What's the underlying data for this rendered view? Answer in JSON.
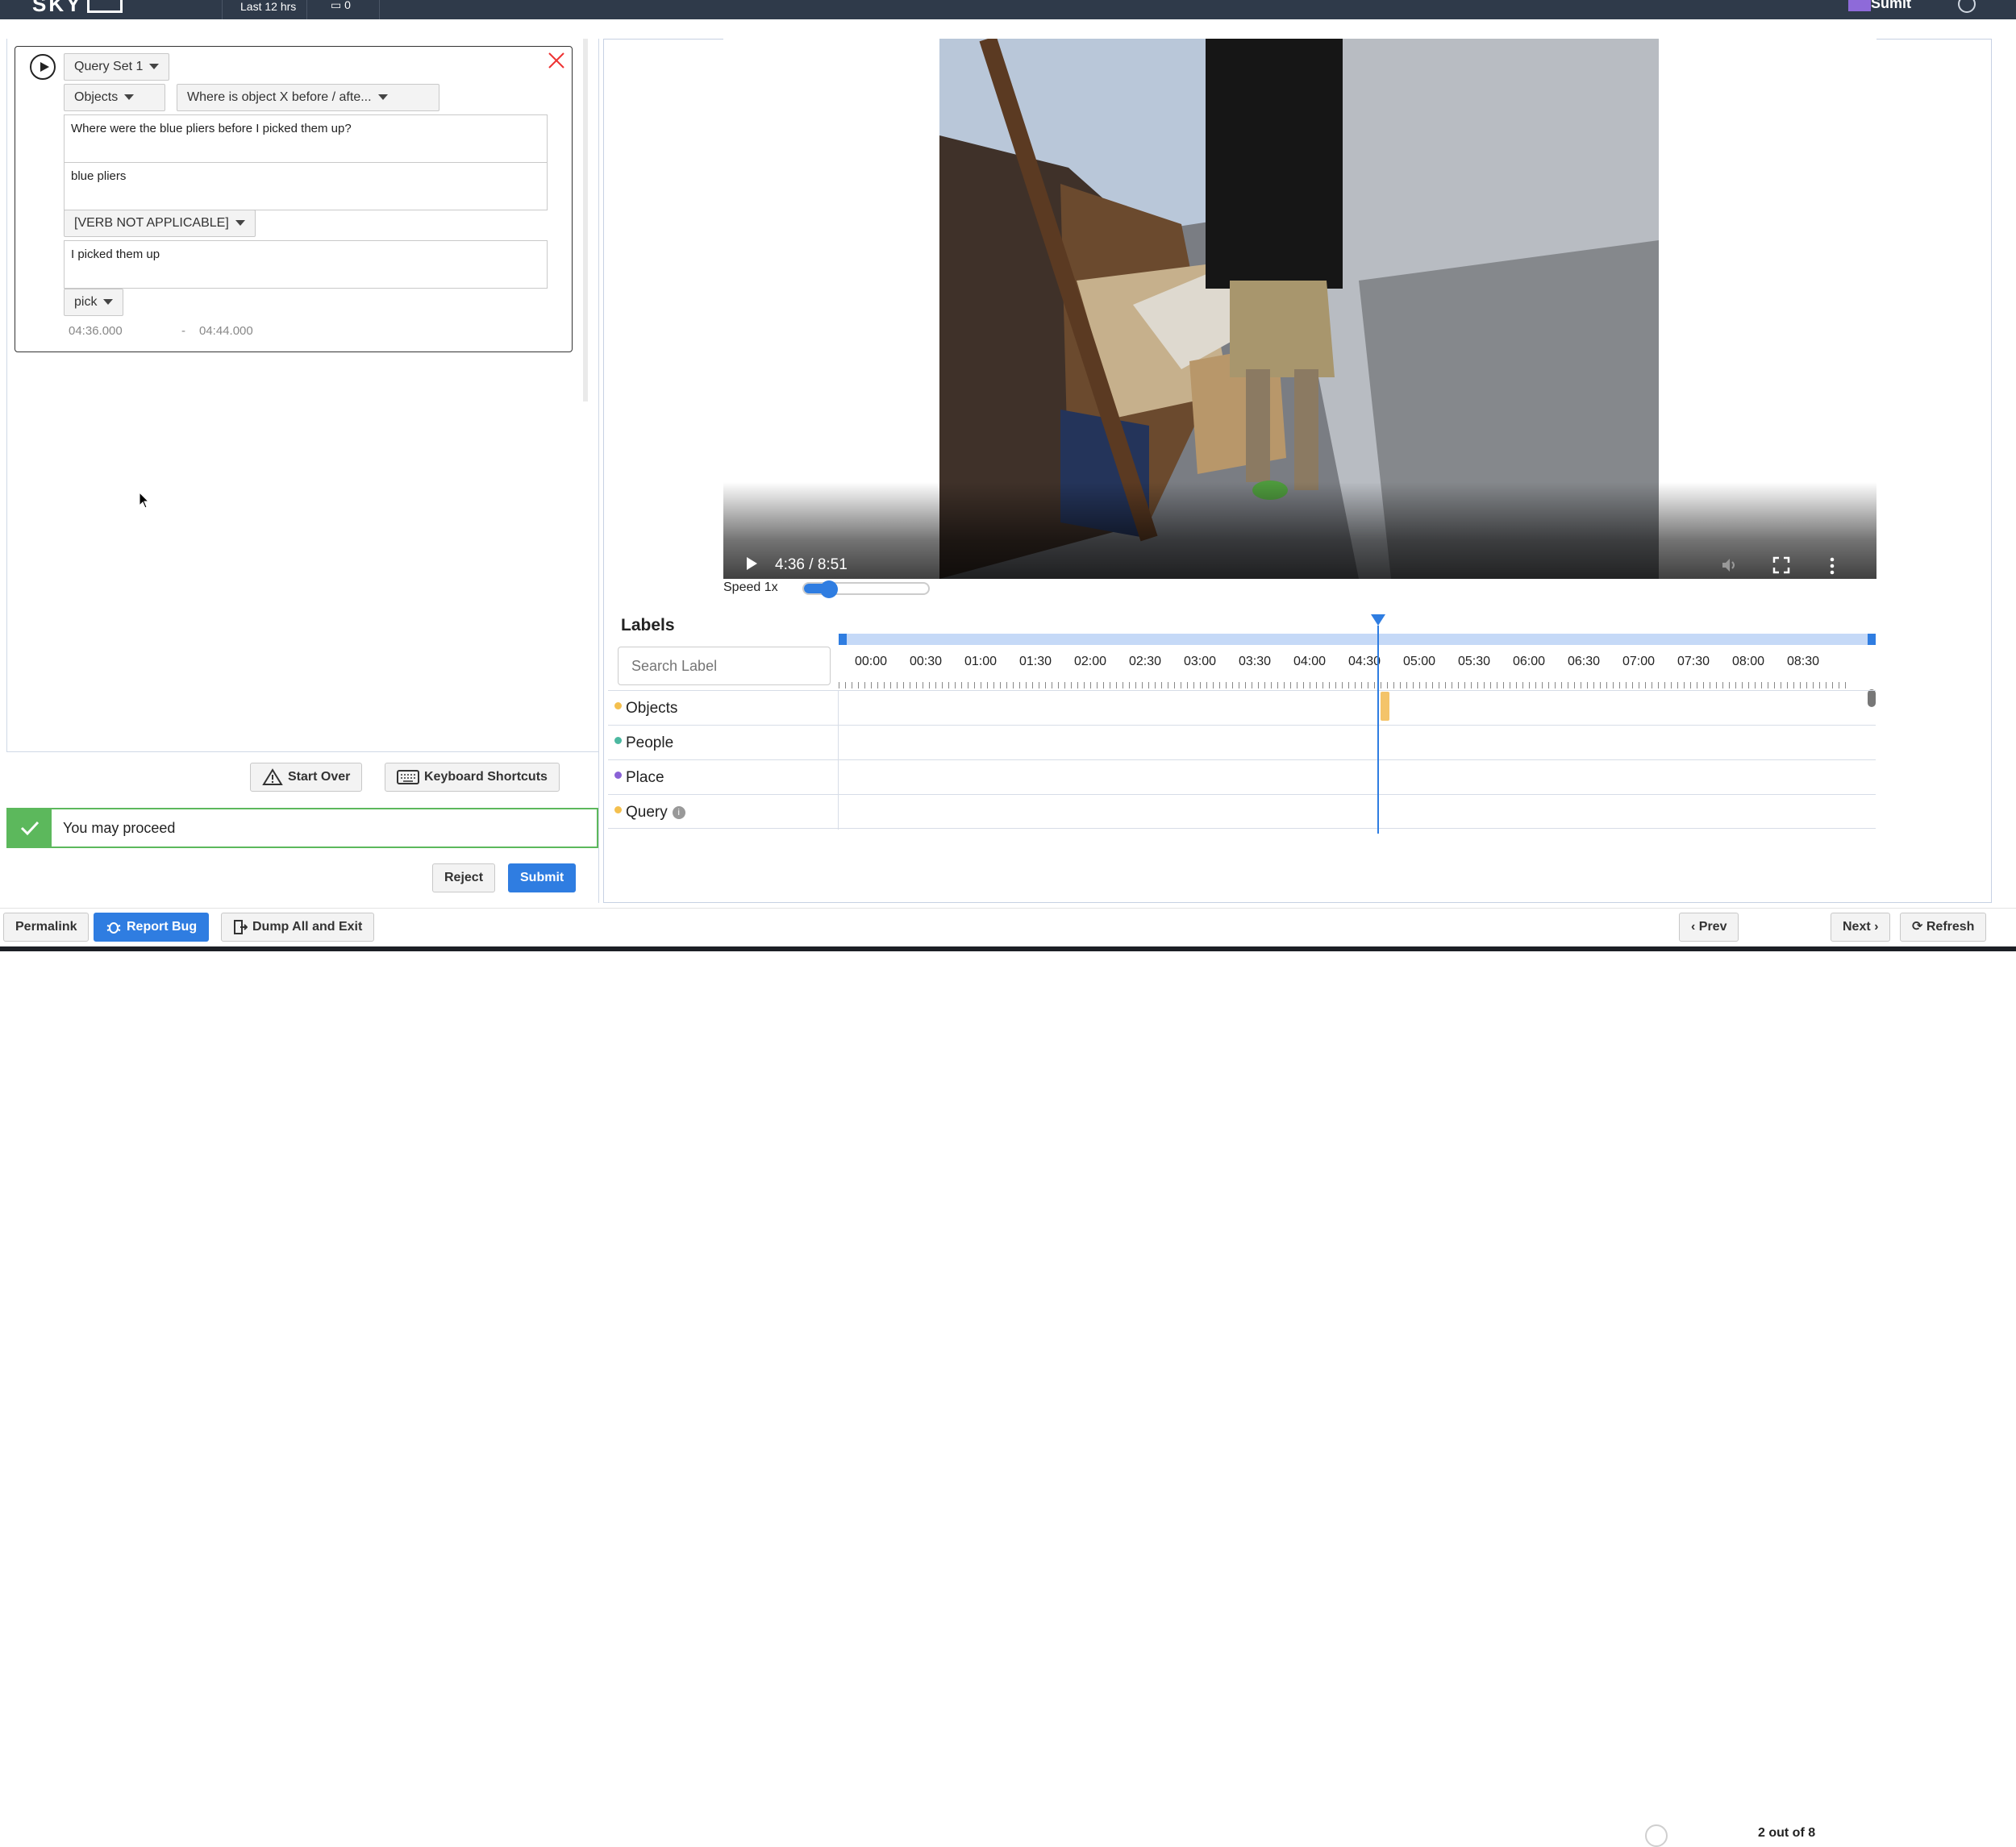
{
  "topbar": {
    "logo_text": "SKY",
    "time_range": "Last 12 hrs",
    "count": "0",
    "user": "Sumit"
  },
  "query": {
    "set_label": "Query Set 1",
    "category": "Objects",
    "template": "Where is object X before / afte...",
    "question": "Where were the blue pliers before I picked them up?",
    "object": "blue pliers",
    "verb_select": "[VERB NOT APPLICABLE]",
    "action_text": "I picked them up",
    "verb": "pick",
    "start_time": "04:36.000",
    "dash": "-",
    "end_time": "04:44.000"
  },
  "actions": {
    "start_over": "Start Over",
    "keyboard_shortcuts": "Keyboard Shortcuts",
    "status_message": "You may proceed",
    "reject": "Reject",
    "submit": "Submit"
  },
  "video": {
    "time_display": "4:36 / 8:51",
    "progress_fraction": 0.52,
    "buffered_fraction": 0.59,
    "speed_label": "Speed 1x",
    "speed_fraction": 0.2
  },
  "labels": {
    "title": "Labels",
    "search_placeholder": "Search Label",
    "ticks": [
      "00:00",
      "00:30",
      "01:00",
      "01:30",
      "02:00",
      "02:30",
      "03:00",
      "03:30",
      "04:00",
      "04:30",
      "05:00",
      "05:30",
      "06:00",
      "06:30",
      "07:00",
      "07:30",
      "08:00",
      "08:30"
    ],
    "rows": [
      {
        "name": "Objects",
        "color": "#f4c04e"
      },
      {
        "name": "People",
        "color": "#4cb8a0"
      },
      {
        "name": "Place",
        "color": "#8a62d6"
      },
      {
        "name": "Query",
        "color": "#f4c04e"
      }
    ]
  },
  "bottom": {
    "permalink": "Permalink",
    "report_bug": "Report Bug",
    "dump_exit": "Dump All and Exit",
    "prev": "Prev",
    "pager": "2 out of 8",
    "next": "Next",
    "refresh": "Refresh"
  }
}
